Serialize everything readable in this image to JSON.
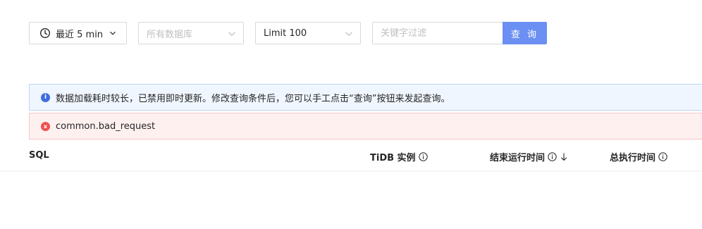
{
  "toolbar": {
    "time_range": "最近 5 min",
    "database_placeholder": "所有数据库",
    "limit": "Limit 100",
    "search_placeholder": "关键字过滤",
    "search_button": "查 询"
  },
  "alerts": {
    "info": "数据加载耗时较长，已禁用即时更新。修改查询条件后，您可以手工点击“查询”按钮来发起查询。",
    "error": "common.bad_request"
  },
  "table": {
    "columns": [
      "SQL",
      "TiDB 实例",
      "结束运行时间",
      "总执行时间"
    ]
  },
  "icons": {
    "clock": "clock-icon",
    "dropdown": "chevron-down-icon",
    "info": "info-circle-icon",
    "error": "close-circle-icon",
    "sort": "arrow-down-icon"
  },
  "colors": {
    "primary_button": "#6b8ff2",
    "info_bg": "#f0f6ff",
    "error_bg": "#fff0f0",
    "info_icon": "#3e6ee0",
    "error_icon": "#f0504f"
  }
}
